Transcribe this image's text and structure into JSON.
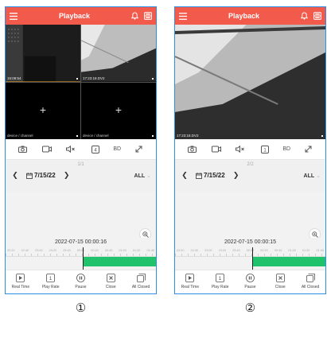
{
  "screens": [
    {
      "title": "Playback",
      "cells": [
        {
          "kind": "video",
          "timestamp": "15:09:54"
        },
        {
          "kind": "video",
          "timestamp": "17:23:18.DV2"
        },
        {
          "kind": "empty",
          "label": "device / channel"
        },
        {
          "kind": "empty",
          "label": "device / channel"
        }
      ],
      "toolbar": {
        "bd_label": "BD"
      },
      "page_indicator": "1/1",
      "date": "7/15/22",
      "filter": "ALL",
      "time_display": "2022-07-15 00:00:16",
      "ticks": [
        "22:20",
        "22:40",
        "23:00",
        "23:20",
        "23:40",
        "00:00",
        "00:20",
        "00:40",
        "01:00",
        "01:20",
        "01:40"
      ],
      "bottom": [
        "Real Time",
        "Play Rate",
        "Pause",
        "Close",
        "All Closed"
      ],
      "caption": "①"
    },
    {
      "title": "Playback",
      "cells": [
        {
          "kind": "video",
          "timestamp": "17:23:18.DV2"
        }
      ],
      "toolbar": {
        "bd_label": "BD"
      },
      "page_indicator": "2/2",
      "date": "7/15/22",
      "filter": "ALL",
      "time_display": "2022-07-15 00:00:15",
      "ticks": [
        "22:20",
        "22:40",
        "23:00",
        "23:20",
        "23:40",
        "00:00",
        "00:20",
        "00:40",
        "01:00",
        "01:20",
        "01:40"
      ],
      "bottom": [
        "Real Time",
        "Play Rate",
        "Pause",
        "Close",
        "All Closed"
      ],
      "caption": "②"
    }
  ],
  "colors": {
    "topbar": "#f25a4c",
    "record": "#21c26c",
    "frame": "#2f8fe6"
  }
}
